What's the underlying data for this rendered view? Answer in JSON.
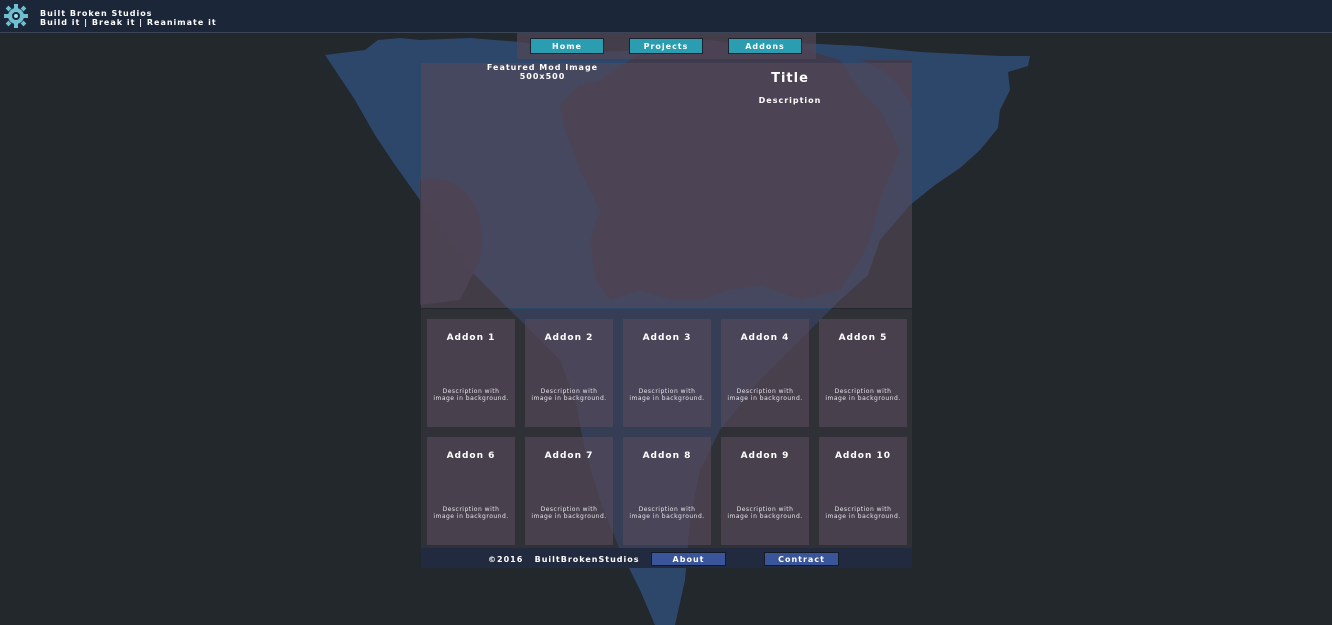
{
  "header": {
    "brand_name": "Built Broken Studios",
    "tagline": "Build it | Break it | Reanimate it",
    "logo_icon": "gear-logo-icon"
  },
  "nav": {
    "items": [
      {
        "label": "Home"
      },
      {
        "label": "Projects"
      },
      {
        "label": "Addons"
      }
    ]
  },
  "hero": {
    "featured_line1": "Featured Mod Image",
    "featured_line2": "500x500",
    "title": "Title",
    "description": "Description"
  },
  "addons": [
    {
      "title": "Addon 1",
      "description": "Description with image in background."
    },
    {
      "title": "Addon 2",
      "description": "Description with image in background."
    },
    {
      "title": "Addon 3",
      "description": "Description with image in background."
    },
    {
      "title": "Addon 4",
      "description": "Description with image in background."
    },
    {
      "title": "Addon 5",
      "description": "Description with image in background."
    },
    {
      "title": "Addon 6",
      "description": "Description with image in background."
    },
    {
      "title": "Addon 7",
      "description": "Description with image in background."
    },
    {
      "title": "Addon 8",
      "description": "Description with image in background."
    },
    {
      "title": "Addon 9",
      "description": "Description with image in background."
    },
    {
      "title": "Addon 10",
      "description": "Description with image in background."
    }
  ],
  "footer": {
    "copyright": "©2016   BuiltBrokenStudios",
    "about_label": "About",
    "contact_label": "Contract"
  },
  "colors": {
    "page_bg": "#23282c",
    "topbar_bg": "#1b2639",
    "nav_button": "#2a9db0",
    "footer_button": "#3a5599",
    "gear_blue": "#2f4d78"
  }
}
